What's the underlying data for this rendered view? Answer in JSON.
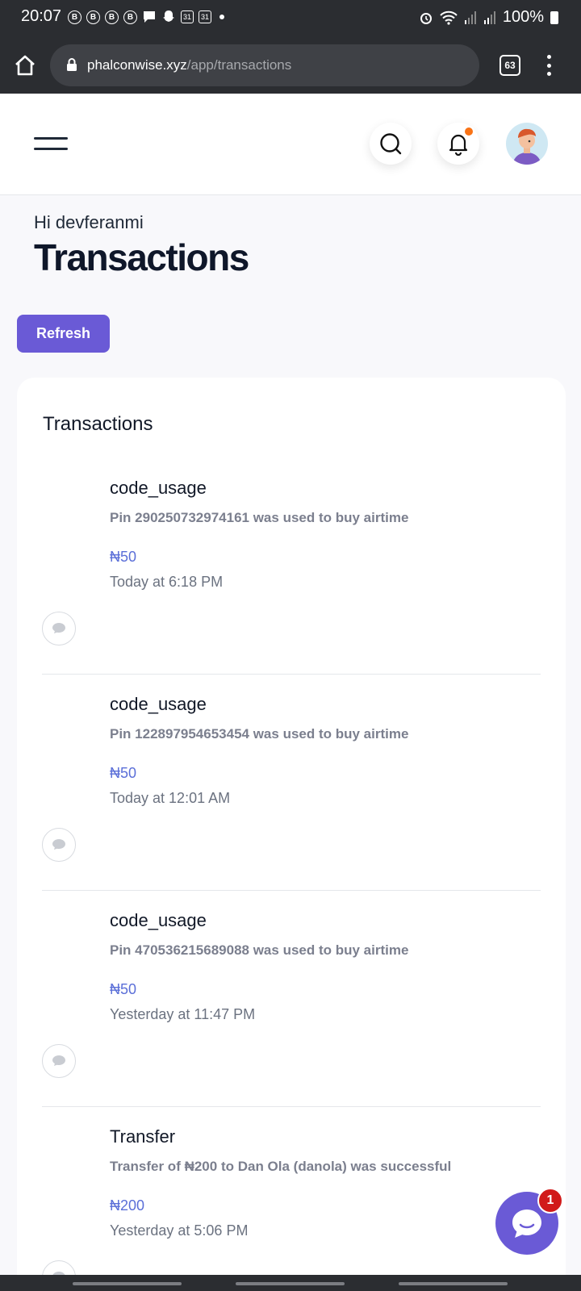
{
  "status_bar": {
    "time": "20:07",
    "notif_icons": [
      "B",
      "B",
      "B",
      "B"
    ],
    "calendar_badges": [
      "31",
      "31"
    ],
    "battery": "100%"
  },
  "browser": {
    "url_domain": "phalconwise.xyz",
    "url_path": "/app/transactions",
    "tab_count": "63"
  },
  "header": {
    "greeting": "Hi devferanmi",
    "page_title": "Transactions",
    "refresh_label": "Refresh"
  },
  "card": {
    "title": "Transactions",
    "transactions": [
      {
        "type": "code_usage",
        "description": "Pin 290250732974161 was used to buy airtime",
        "amount": "₦50",
        "time": "Today at 6:18 PM"
      },
      {
        "type": "code_usage",
        "description": "Pin 122897954653454 was used to buy airtime",
        "amount": "₦50",
        "time": "Today at 12:01 AM"
      },
      {
        "type": "code_usage",
        "description": "Pin 470536215689088 was used to buy airtime",
        "amount": "₦50",
        "time": "Yesterday at 11:47 PM"
      },
      {
        "type": "Transfer",
        "description": "Transfer of ₦200 to Dan Ola (danola) was successful",
        "amount": "₦200",
        "time": "Yesterday at 5:06 PM"
      }
    ]
  },
  "chat": {
    "badge": "1"
  },
  "colors": {
    "accent": "#6a5ad6",
    "amount": "#5b6fd8",
    "notification": "#f97316",
    "badge": "#d11a1a"
  },
  "icons": [
    "home-icon",
    "lock-icon",
    "tabs-icon",
    "more-icon",
    "menu-icon",
    "search-icon",
    "bell-icon",
    "avatar",
    "comment-icon",
    "chat-icon"
  ]
}
